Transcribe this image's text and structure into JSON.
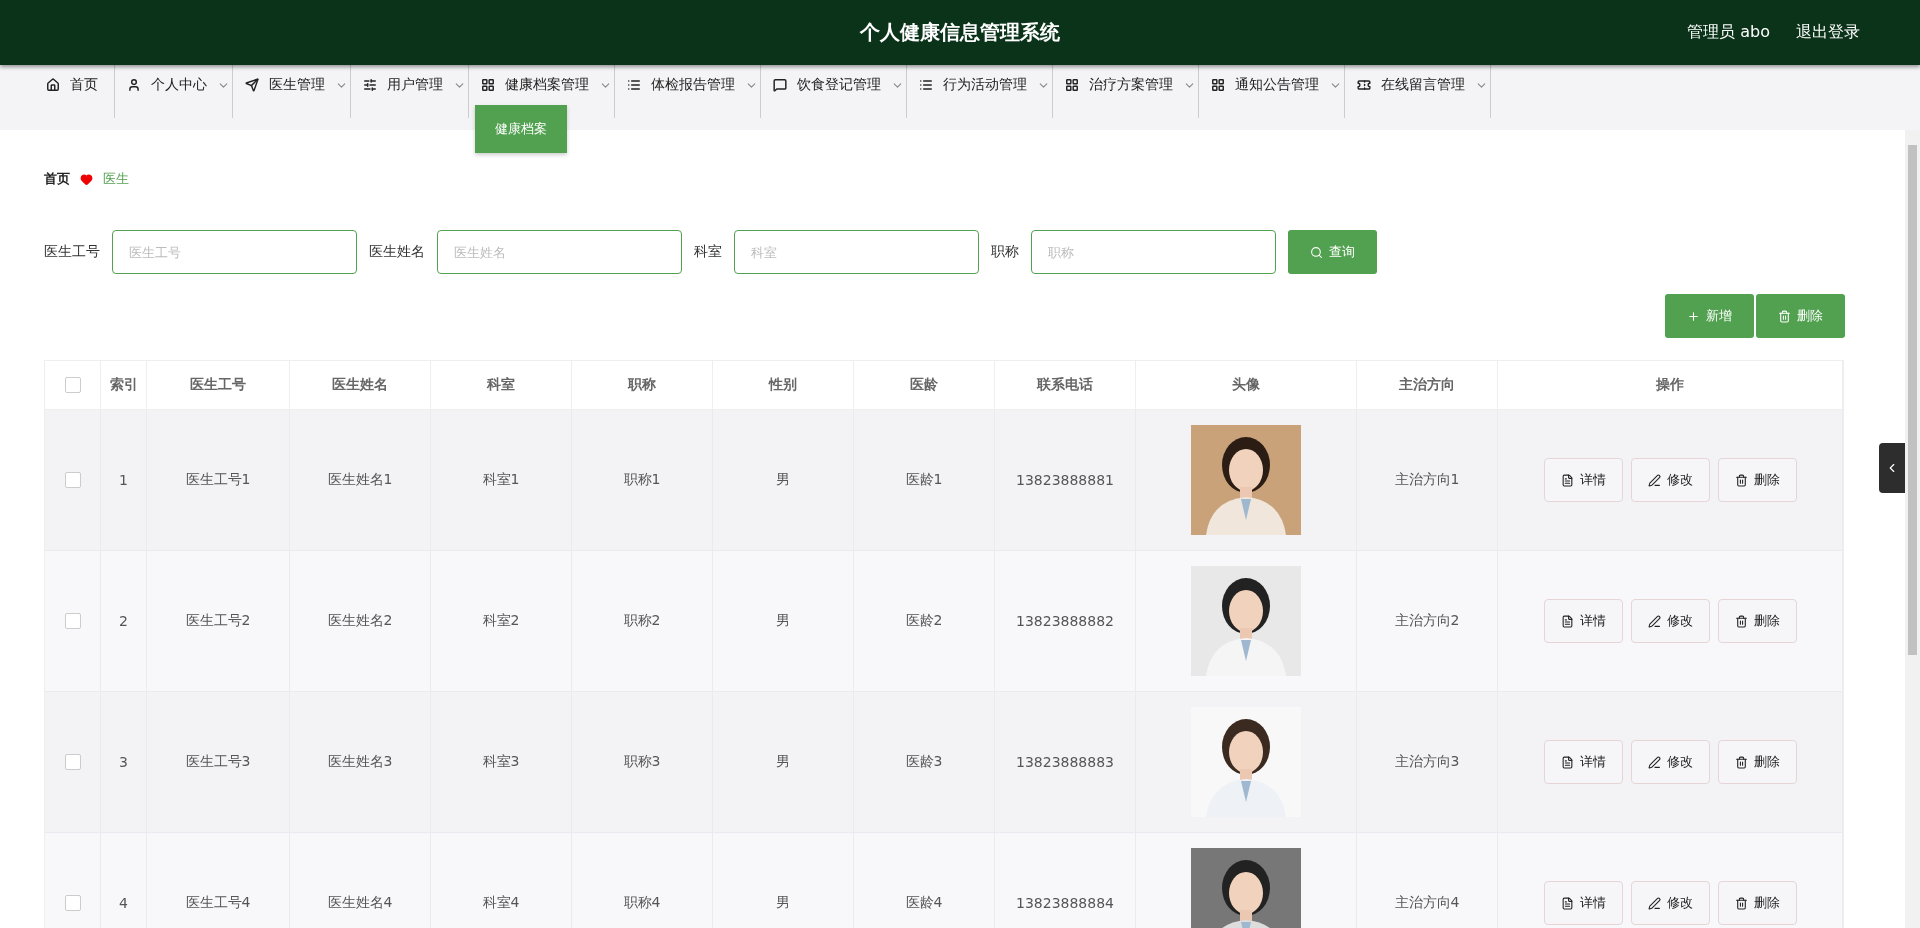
{
  "header": {
    "title": "个人健康信息管理系统",
    "user": "管理员 abo",
    "logout": "退出登录"
  },
  "nav": [
    {
      "kind": "home",
      "label": "首页",
      "has_menu": false
    },
    {
      "kind": "person",
      "label": "个人中心",
      "has_menu": true
    },
    {
      "kind": "plane",
      "label": "医生管理",
      "has_menu": true
    },
    {
      "kind": "sliders",
      "label": "用户管理",
      "has_menu": true
    },
    {
      "kind": "grid",
      "label": "健康档案管理",
      "has_menu": true,
      "submenu": [
        "健康档案"
      ]
    },
    {
      "kind": "list",
      "label": "体检报告管理",
      "has_menu": true
    },
    {
      "kind": "chat",
      "label": "饮食登记管理",
      "has_menu": true
    },
    {
      "kind": "list",
      "label": "行为活动管理",
      "has_menu": true
    },
    {
      "kind": "grid",
      "label": "治疗方案管理",
      "has_menu": true
    },
    {
      "kind": "grid",
      "label": "通知公告管理",
      "has_menu": true
    },
    {
      "kind": "ticket",
      "label": "在线留言管理",
      "has_menu": true
    }
  ],
  "breadcrumb": [
    "首页",
    "医生"
  ],
  "search": {
    "fields": [
      {
        "label": "医生工号",
        "placeholder": "医生工号"
      },
      {
        "label": "医生姓名",
        "placeholder": "医生姓名"
      },
      {
        "label": "科室",
        "placeholder": "科室"
      },
      {
        "label": "职称",
        "placeholder": "职称"
      }
    ],
    "button": "查询"
  },
  "actions": [
    "新增",
    "删除"
  ],
  "table": {
    "all_checked": false,
    "columns": [
      "索引",
      "医生工号",
      "医生姓名",
      "科室",
      "职称",
      "性别",
      "医龄",
      "联系电话",
      "头像",
      "主治方向",
      "操作"
    ],
    "rows": [
      {
        "checked": false,
        "cells": [
          "1",
          "医生工号1",
          "医生姓名1",
          "科室1",
          "职称1",
          "男",
          "医龄1",
          "13823888881"
        ],
        "direction": "主治方向1",
        "actions": [
          "详情",
          "修改",
          "删除"
        ]
      },
      {
        "checked": false,
        "cells": [
          "2",
          "医生工号2",
          "医生姓名2",
          "科室2",
          "职称2",
          "男",
          "医龄2",
          "13823888882"
        ],
        "direction": "主治方向2",
        "actions": [
          "详情",
          "修改",
          "删除"
        ]
      },
      {
        "checked": false,
        "cells": [
          "3",
          "医生工号3",
          "医生姓名3",
          "科室3",
          "职称3",
          "男",
          "医龄3",
          "13823888883"
        ],
        "direction": "主治方向3",
        "actions": [
          "详情",
          "修改",
          "删除"
        ]
      },
      {
        "checked": false,
        "cells": [
          "4",
          "医生工号4",
          "医生姓名4",
          "科室4",
          "职称4",
          "男",
          "医龄4",
          "13823888884"
        ],
        "direction": "主治方向4",
        "actions": [
          "详情",
          "修改",
          "删除"
        ]
      }
    ]
  }
}
